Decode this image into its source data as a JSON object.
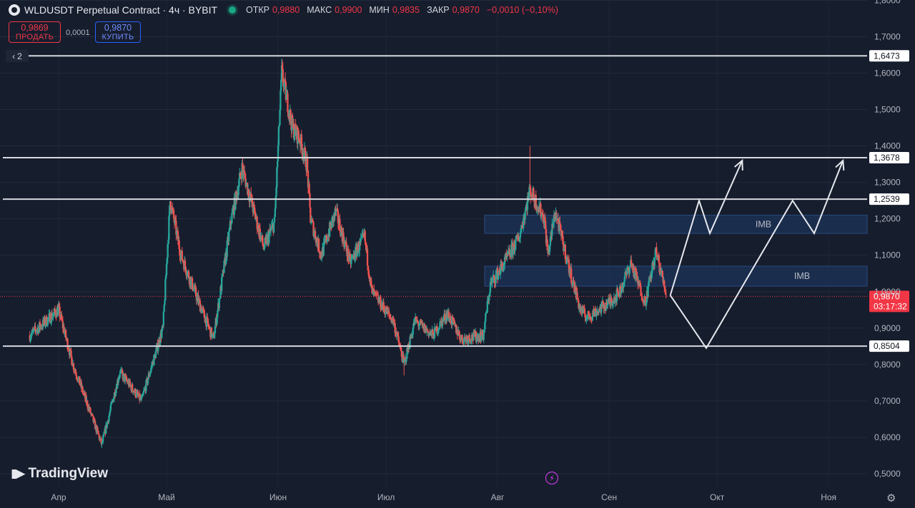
{
  "header": {
    "title": "WLDUSDT Perpetual Contract · 4ч · BYBIT",
    "open_label": "ОТКР",
    "open_value": "0,9880",
    "high_label": "МАКС",
    "high_value": "0,9900",
    "low_label": "МИН",
    "low_value": "0,9835",
    "close_label": "ЗАКР",
    "close_value": "0,9870",
    "change": "−0,0010 (−0,10%)"
  },
  "trade": {
    "sell_price": "0,9869",
    "sell_label": "ПРОДАТЬ",
    "spread": "0,0001",
    "buy_price": "0,9870",
    "buy_label": "КУПИТЬ"
  },
  "collapse_count": "2",
  "brand": "TradingView",
  "colors": {
    "background": "#161d2d",
    "up": "#26a69a",
    "down": "#ef5350",
    "level_line": "#d7d9df",
    "zone_fill": "#1c3357",
    "zone_border": "#2a4a80",
    "price_tag": "#f23645",
    "projection": "#e6e8ee",
    "accent_buy": "#2962ff"
  },
  "chart_data": {
    "type": "candlestick",
    "symbol": "WLDUSDT",
    "timeframe": "4ч",
    "price_axis_ticks": [
      "1,8000",
      "1,7000",
      "1,6000",
      "1,5000",
      "1,4000",
      "1,3000",
      "1,2000",
      "1,1000",
      "1,0000",
      "0,9000",
      "0,8000",
      "0,7000",
      "0,6000",
      "0,5000"
    ],
    "ylim": [
      0.485,
      1.815
    ],
    "time_axis_labels": [
      "Апр",
      "Май",
      "Июн",
      "Июл",
      "Авг",
      "Сен",
      "Окт",
      "Ноя"
    ],
    "approx_close_path": [
      {
        "date": "2024-03-24",
        "price": 0.88
      },
      {
        "date": "2024-04-01",
        "price": 0.95
      },
      {
        "date": "2024-04-05",
        "price": 0.8
      },
      {
        "date": "2024-04-13",
        "price": 0.58
      },
      {
        "date": "2024-04-18",
        "price": 0.78
      },
      {
        "date": "2024-04-24",
        "price": 0.7
      },
      {
        "date": "2024-04-30",
        "price": 0.9
      },
      {
        "date": "2024-05-02",
        "price": 1.25
      },
      {
        "date": "2024-05-05",
        "price": 1.1
      },
      {
        "date": "2024-05-10",
        "price": 0.97
      },
      {
        "date": "2024-05-14",
        "price": 0.87
      },
      {
        "date": "2024-05-19",
        "price": 1.2
      },
      {
        "date": "2024-05-22",
        "price": 1.34
      },
      {
        "date": "2024-05-25",
        "price": 1.23
      },
      {
        "date": "2024-05-28",
        "price": 1.12
      },
      {
        "date": "2024-05-31",
        "price": 1.19
      },
      {
        "date": "2024-06-02",
        "price": 1.6
      },
      {
        "date": "2024-06-05",
        "price": 1.45
      },
      {
        "date": "2024-06-07",
        "price": 1.42
      },
      {
        "date": "2024-06-09",
        "price": 1.35
      },
      {
        "date": "2024-06-10",
        "price": 1.2
      },
      {
        "date": "2024-06-13",
        "price": 1.1
      },
      {
        "date": "2024-06-17",
        "price": 1.22
      },
      {
        "date": "2024-06-21",
        "price": 1.08
      },
      {
        "date": "2024-06-25",
        "price": 1.15
      },
      {
        "date": "2024-06-27",
        "price": 1.0
      },
      {
        "date": "2024-07-03",
        "price": 0.92
      },
      {
        "date": "2024-07-06",
        "price": 0.8
      },
      {
        "date": "2024-07-09",
        "price": 0.92
      },
      {
        "date": "2024-07-14",
        "price": 0.88
      },
      {
        "date": "2024-07-18",
        "price": 0.94
      },
      {
        "date": "2024-07-22",
        "price": 0.87
      },
      {
        "date": "2024-07-28",
        "price": 0.88
      },
      {
        "date": "2024-07-30",
        "price": 1.02
      },
      {
        "date": "2024-08-03",
        "price": 1.08
      },
      {
        "date": "2024-08-07",
        "price": 1.15
      },
      {
        "date": "2024-08-10",
        "price": 1.28
      },
      {
        "date": "2024-08-14",
        "price": 1.2
      },
      {
        "date": "2024-08-15",
        "price": 1.1
      },
      {
        "date": "2024-08-17",
        "price": 1.22
      },
      {
        "date": "2024-08-21",
        "price": 1.06
      },
      {
        "date": "2024-08-24",
        "price": 0.95
      },
      {
        "date": "2024-08-26",
        "price": 0.93
      },
      {
        "date": "2024-09-01",
        "price": 0.97
      },
      {
        "date": "2024-09-04",
        "price": 1.0
      },
      {
        "date": "2024-09-07",
        "price": 1.08
      },
      {
        "date": "2024-09-11",
        "price": 0.97
      },
      {
        "date": "2024-09-14",
        "price": 1.11
      },
      {
        "date": "2024-09-17",
        "price": 0.99
      }
    ],
    "approx_wick_extremes": [
      {
        "date": "2024-04-13",
        "low": 0.57
      },
      {
        "date": "2024-06-02",
        "high": 1.64
      },
      {
        "date": "2024-07-06",
        "low": 0.77
      },
      {
        "date": "2024-08-10",
        "high": 1.4
      }
    ],
    "horizontal_levels": [
      {
        "price": 1.6473,
        "label": "1,6473"
      },
      {
        "price": 1.3678,
        "label": "1,3678"
      },
      {
        "price": 1.2539,
        "label": "1,2539"
      },
      {
        "price": 0.8504,
        "label": "0,8504"
      }
    ],
    "zones": [
      {
        "label": "IMB",
        "price_top": 1.21,
        "price_bottom": 1.16
      },
      {
        "label": "IMB",
        "price_top": 1.07,
        "price_bottom": 1.015
      }
    ],
    "current_price": {
      "label": "0,9870",
      "price": 0.987,
      "countdown": "03:17:32"
    },
    "projections": [
      {
        "points": [
          {
            "date": "2024-09-18",
            "price": 0.99
          },
          {
            "date": "2024-09-26",
            "price": 1.25
          },
          {
            "date": "2024-09-29",
            "price": 1.16
          },
          {
            "date": "2024-10-08",
            "price": 1.36
          }
        ]
      },
      {
        "points": [
          {
            "date": "2024-09-18",
            "price": 0.99
          },
          {
            "date": "2024-09-28",
            "price": 0.845
          },
          {
            "date": "2024-10-22",
            "price": 1.25
          },
          {
            "date": "2024-10-28",
            "price": 1.16
          },
          {
            "date": "2024-11-05",
            "price": 1.36
          }
        ]
      }
    ]
  }
}
